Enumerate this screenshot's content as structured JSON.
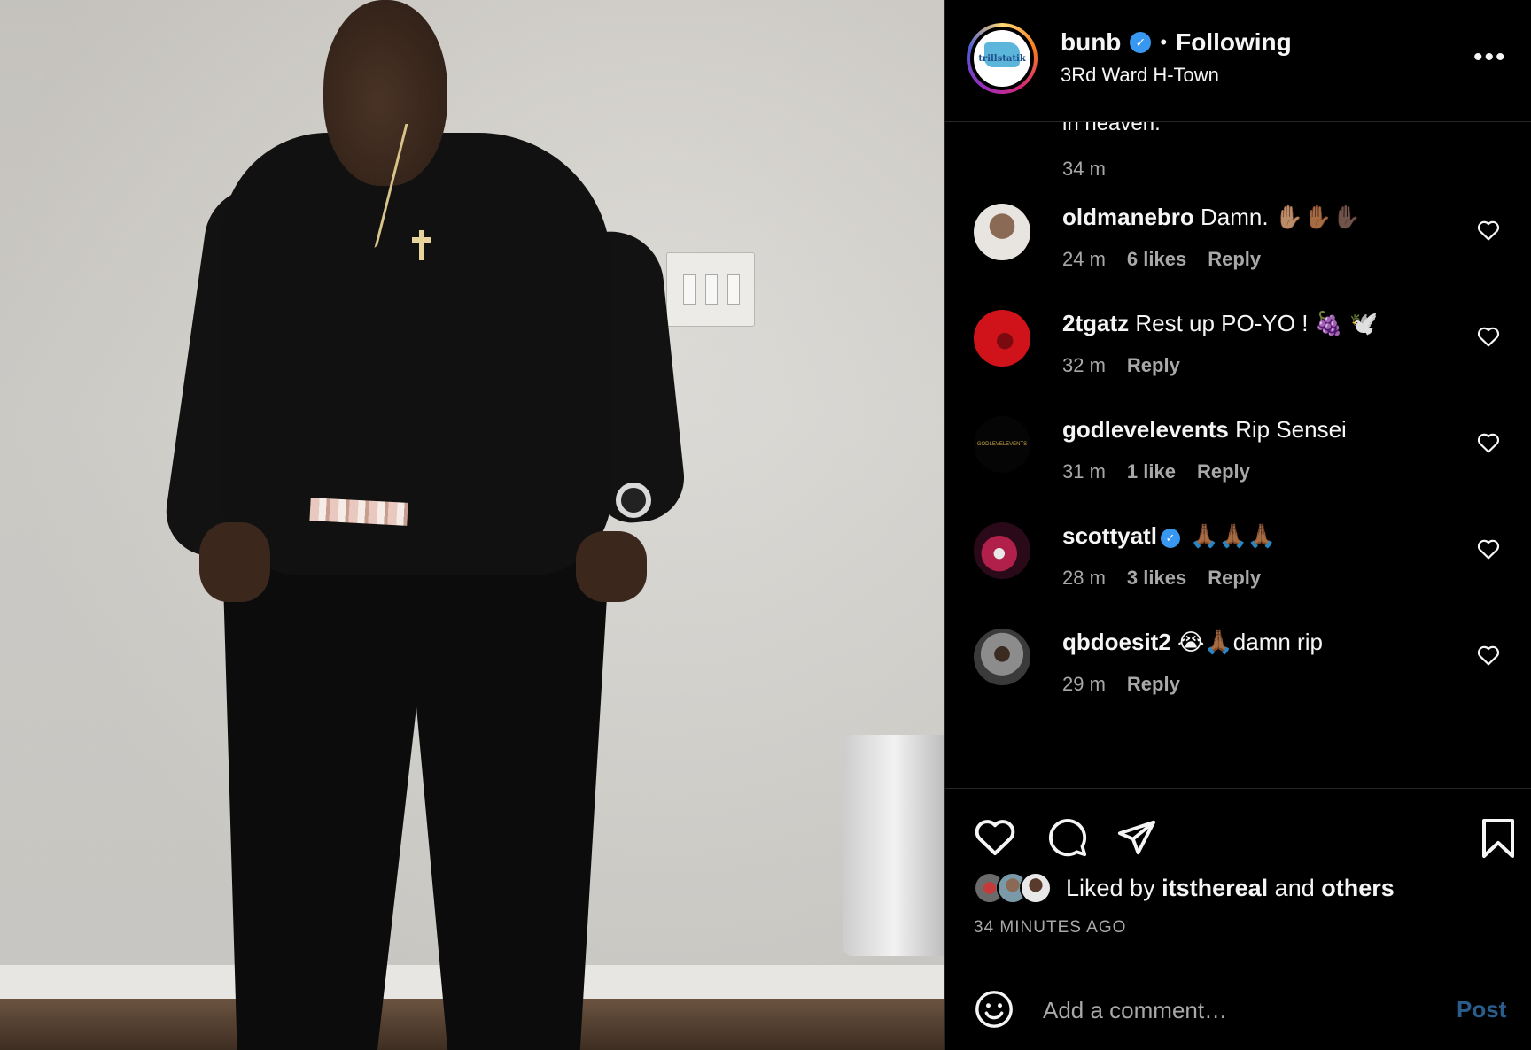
{
  "post": {
    "username": "bunb",
    "verified": true,
    "separator": "•",
    "follow_status": "Following",
    "location": "3Rd Ward H-Town",
    "more_label": "•••",
    "avatar_text": "trillstatik"
  },
  "comments": {
    "partial_text": "in heaven.",
    "partial_time": "34 m",
    "items": [
      {
        "user": "oldmanebro",
        "verified": false,
        "text": "Damn. ✋🏽✋🏾✋🏿",
        "time": "24 m",
        "likes": "6 likes",
        "reply": "Reply",
        "avatar_color": "#d9d4cf"
      },
      {
        "user": "2tgatz",
        "verified": false,
        "text": "Rest up PO-YO ! 🍇 🕊️",
        "time": "32 m",
        "likes": "",
        "reply": "Reply",
        "avatar_color": "#d0121b"
      },
      {
        "user": "godlevelevents",
        "verified": false,
        "text": "Rip Sensei",
        "time": "31 m",
        "likes": "1 like",
        "reply": "Reply",
        "avatar_color": "#050505",
        "avatar_text": "GODLEVELEVENTS"
      },
      {
        "user": "scottyatl",
        "verified": true,
        "text": "🙏🏾🙏🏾🙏🏾",
        "time": "28 m",
        "likes": "3 likes",
        "reply": "Reply",
        "avatar_color": "#8a1a3a"
      },
      {
        "user": "qbdoesit2",
        "verified": false,
        "text": "😭🙏🏾damn rip",
        "time": "29 m",
        "likes": "",
        "reply": "Reply",
        "avatar_color": "#5a5a5a"
      }
    ]
  },
  "actions": {
    "liked_prefix": "Liked by",
    "liked_user": "itsthereal",
    "liked_and": "and",
    "liked_others": "others",
    "time_ago": "34 MINUTES AGO"
  },
  "compose": {
    "placeholder": "Add a comment…",
    "post_label": "Post"
  },
  "icons": {
    "verified": "verified-badge-icon",
    "like": "heart-icon",
    "comment": "comment-icon",
    "share": "paper-plane-icon",
    "save": "bookmark-icon",
    "emoji": "smiley-icon"
  },
  "colors": {
    "background": "#000000",
    "text": "#f5f5f5",
    "muted": "#a8a8a8",
    "verified": "#3897f0",
    "post_button_disabled": "#2a5d8b"
  }
}
